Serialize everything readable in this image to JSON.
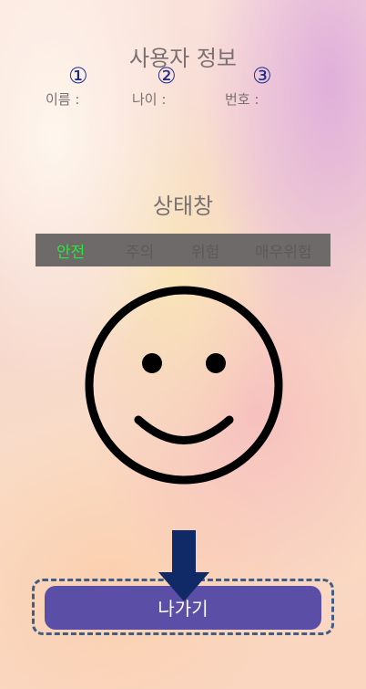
{
  "user_info": {
    "title": "사용자 정보",
    "fields": [
      {
        "badge": "①",
        "label": "이름 :"
      },
      {
        "badge": "②",
        "label": "나이 :"
      },
      {
        "badge": "③",
        "label": "번호 :"
      }
    ]
  },
  "status": {
    "title": "상태창",
    "levels": [
      "안전",
      "주의",
      "위험",
      "매우위험"
    ],
    "active_level": "안전",
    "active_color": "#27e83a"
  },
  "face_icon": "smiley-face-icon",
  "exit_button": {
    "label": "나가기"
  },
  "arrow_icon": "down-arrow-icon",
  "colors": {
    "button": "#5a4ea6",
    "badge": "#1a2a8a",
    "arrow": "#0f2a66"
  }
}
